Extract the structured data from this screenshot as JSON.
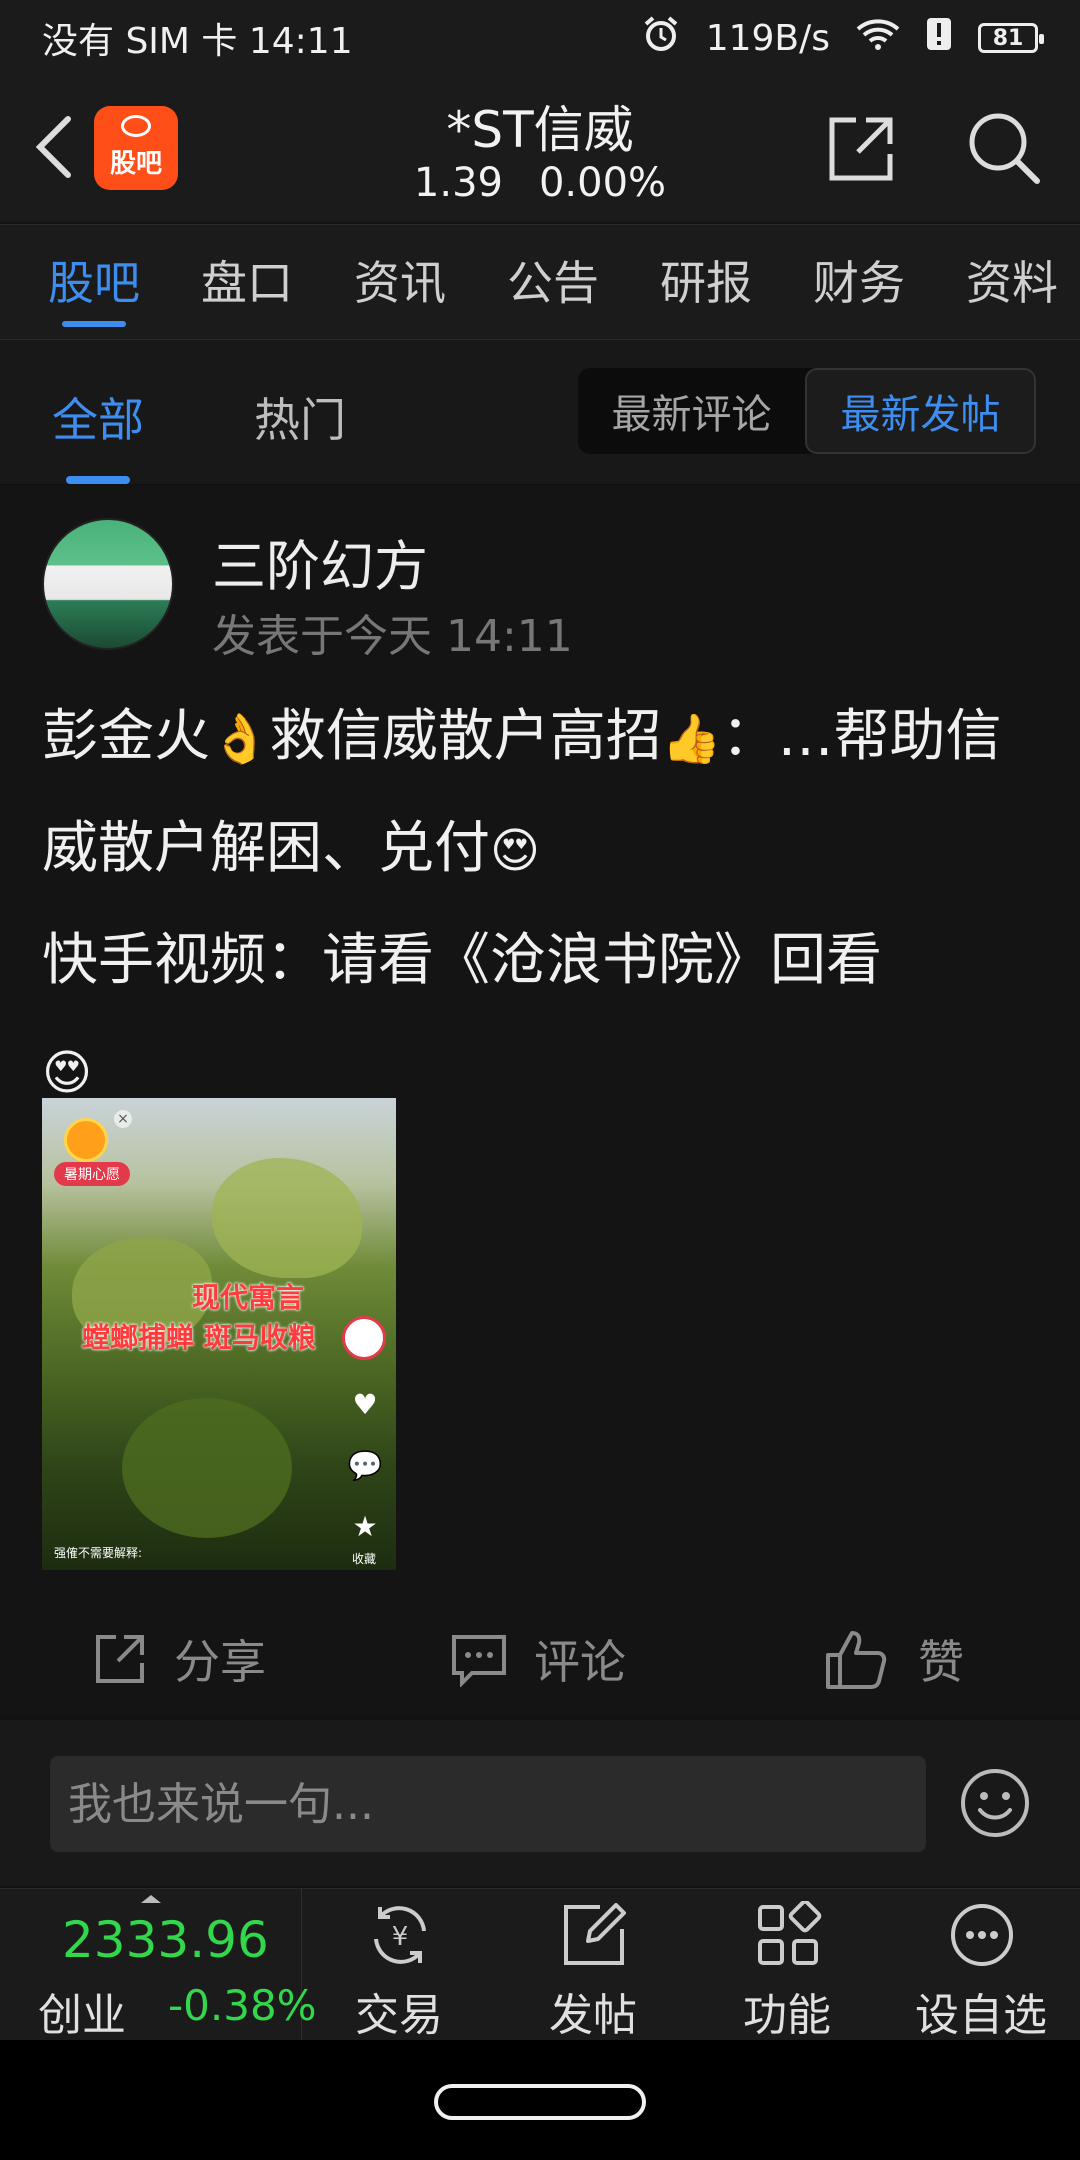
{
  "status_bar": {
    "left": "没有 SIM 卡 14:11",
    "net_speed": "119B/s",
    "battery": "81"
  },
  "header": {
    "app_logo_text": "股吧",
    "stock_name": "*ST信威",
    "price": "1.39",
    "change_pct": "0.00%"
  },
  "main_tabs": [
    {
      "label": "股吧",
      "active": true
    },
    {
      "label": "盘口"
    },
    {
      "label": "资讯"
    },
    {
      "label": "公告"
    },
    {
      "label": "研报"
    },
    {
      "label": "财务"
    },
    {
      "label": "资料"
    }
  ],
  "sub_tabs": {
    "all": "全部",
    "hot": "热门",
    "sort_options": [
      "最新评论",
      "最新发帖"
    ],
    "active_sort": "最新发帖"
  },
  "post": {
    "author": "三阶幻方",
    "time": "发表于今天 14:11",
    "line1": "彭金火",
    "line1_b": "救信威散户高招",
    "line1_c": "：…帮助信威散户解困、兑付",
    "line2": "快手视频：请看《沧浪书院》回看",
    "video_text_1": "现代寓言",
    "video_text_2": "螳螂捕蝉  斑马收粮",
    "video_badge": "暑期心愿",
    "video_caption": "强傕不需要解释:",
    "video_collect": "收藏",
    "actions": {
      "share": "分享",
      "comment": "评论",
      "like": "赞"
    }
  },
  "comment": {
    "placeholder": "我也来说一句..."
  },
  "bottom_bar": {
    "index_value": "2333.96",
    "index_name": "创业",
    "index_change": "-0.38%",
    "buttons": [
      "交易",
      "发帖",
      "功能",
      "设自选"
    ]
  },
  "colors": {
    "accent": "#3d8ef0",
    "brand": "#ff4e17",
    "up_green": "#32d74b"
  },
  "icons": [
    "back-icon",
    "share-icon",
    "search-icon",
    "smile-icon",
    "trade-icon",
    "edit-icon",
    "grid-icon",
    "more-icon",
    "thumb-up-icon",
    "comment-icon",
    "alarm-icon",
    "wifi-icon"
  ]
}
